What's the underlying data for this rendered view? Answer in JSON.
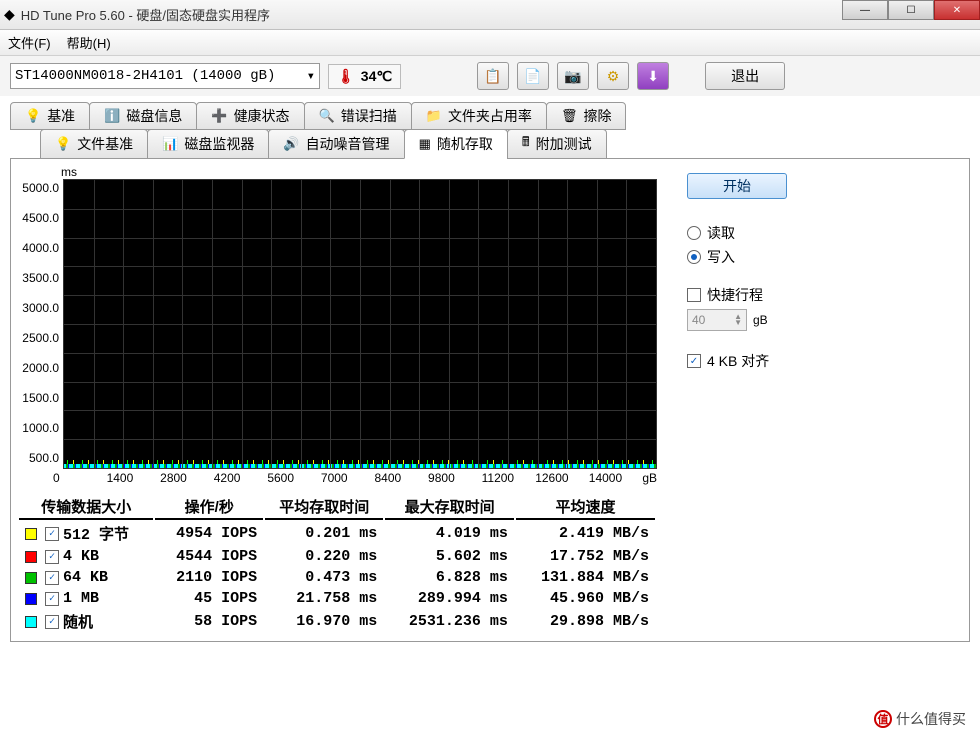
{
  "window": {
    "title": "HD Tune Pro 5.60 - 硬盘/固态硬盘实用程序",
    "min": "—",
    "max": "☐",
    "close": "✕"
  },
  "menu": {
    "file": "文件(F)",
    "help": "帮助(H)"
  },
  "drive": "ST14000NM0018-2H4101 (14000 gB)",
  "temp": "34℃",
  "exit": "退出",
  "tabs_row1": [
    {
      "icon": "💡",
      "label": "基准"
    },
    {
      "icon": "ℹ️",
      "label": "磁盘信息"
    },
    {
      "icon": "➕",
      "label": "健康状态"
    },
    {
      "icon": "🔍",
      "label": "错误扫描"
    },
    {
      "icon": "📁",
      "label": "文件夹占用率"
    },
    {
      "icon": "🗑",
      "label": "擦除"
    }
  ],
  "tabs_row2": [
    {
      "icon": "💡",
      "label": "文件基准"
    },
    {
      "icon": "📊",
      "label": "磁盘监视器"
    },
    {
      "icon": "🔊",
      "label": "自动噪音管理"
    },
    {
      "icon": "▦",
      "label": "随机存取",
      "active": true
    },
    {
      "icon": "🖩",
      "label": "附加测试"
    }
  ],
  "sidebar": {
    "start": "开始",
    "read": "读取",
    "write": "写入",
    "shortstroke": "快捷行程",
    "shortstroke_val": "40",
    "shortstroke_unit": "gB",
    "align": "4 KB 对齐"
  },
  "chart_data": {
    "type": "scatter",
    "title": "",
    "yunit": "ms",
    "ylim": [
      0,
      5000
    ],
    "yticks": [
      500,
      1000,
      1500,
      2000,
      2500,
      3000,
      3500,
      4000,
      4500,
      5000
    ],
    "xticks": [
      0,
      1400,
      2800,
      4200,
      5600,
      7000,
      8400,
      9800,
      11200,
      12600,
      14000
    ],
    "xunit": "gB",
    "note": "dense noise near 0 ms across full x range; sparse outliers up to ~2500 ms"
  },
  "table": {
    "headers": [
      "传输数据大小",
      "操作/秒",
      "平均存取时间",
      "最大存取时间",
      "平均速度"
    ],
    "rows": [
      {
        "color": "#ffff00",
        "checked": true,
        "label": "512 字节",
        "iops": "4954 IOPS",
        "avg": "0.201 ms",
        "max": "4.019 ms",
        "speed": "2.419 MB/s"
      },
      {
        "color": "#ff0000",
        "checked": true,
        "label": "4 KB",
        "iops": "4544 IOPS",
        "avg": "0.220 ms",
        "max": "5.602 ms",
        "speed": "17.752 MB/s"
      },
      {
        "color": "#00c000",
        "checked": true,
        "label": "64 KB",
        "iops": "2110 IOPS",
        "avg": "0.473 ms",
        "max": "6.828 ms",
        "speed": "131.884 MB/s"
      },
      {
        "color": "#0000ff",
        "checked": true,
        "label": "1 MB",
        "iops": "45 IOPS",
        "avg": "21.758 ms",
        "max": "289.994 ms",
        "speed": "45.960 MB/s"
      },
      {
        "color": "#00ffff",
        "checked": true,
        "label": "随机",
        "iops": "58 IOPS",
        "avg": "16.970 ms",
        "max": "2531.236 ms",
        "speed": "29.898 MB/s"
      }
    ]
  },
  "watermark": "什么值得买"
}
